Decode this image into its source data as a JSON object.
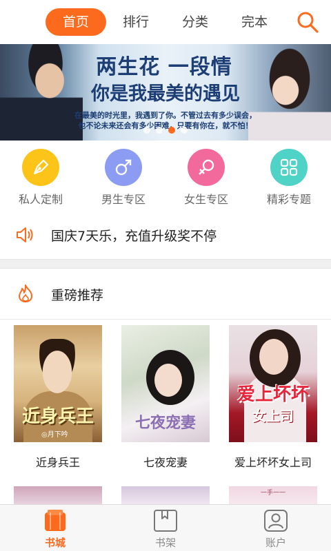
{
  "topnav": {
    "tabs": [
      {
        "label": "首页",
        "active": true
      },
      {
        "label": "排行",
        "active": false
      },
      {
        "label": "分类",
        "active": false
      },
      {
        "label": "完本",
        "active": false
      }
    ],
    "search_icon": "search-icon",
    "accent_color": "#fb6a1d"
  },
  "banner": {
    "title_line1": "两生花 一段情",
    "title_line2": "你是我最美的遇见",
    "subtitle_line1": "在最美的时光里，我遇到了你。不管过去有多少误会，",
    "subtitle_line2": "也不论未来还会有多少困难，只要有你在，就不怕！",
    "dots_count": 4,
    "active_dot_index": 2
  },
  "categories": [
    {
      "label": "私人定制",
      "icon": "pen-nib-icon",
      "color": "#fcc419"
    },
    {
      "label": "男生专区",
      "icon": "male-symbol-icon",
      "color": "#8b9cf2"
    },
    {
      "label": "女生专区",
      "icon": "female-symbol-icon",
      "color": "#f26a9b"
    },
    {
      "label": "精彩专题",
      "icon": "grid-icon",
      "color": "#4fd3c7"
    }
  ],
  "notice": {
    "icon": "speaker-icon",
    "text": "国庆7天乐，充值升级奖不停"
  },
  "section": {
    "icon": "fire-icon",
    "title": "重磅推荐"
  },
  "books": [
    {
      "title": "近身兵王",
      "cover_title": "近身兵王",
      "cover_author": "◎月下吟"
    },
    {
      "title": "七夜宠妻",
      "cover_title": "七夜宠妻"
    },
    {
      "title": "爱上坏坏女上司",
      "cover_title": "爱上坏坏",
      "cover_title2": "女上司"
    }
  ],
  "peek_row": {
    "third_text": "一手一一"
  },
  "bottombar": {
    "items": [
      {
        "label": "书城",
        "icon": "bookstore-icon",
        "active": true
      },
      {
        "label": "书架",
        "icon": "bookshelf-icon",
        "active": false
      },
      {
        "label": "账户",
        "icon": "account-icon",
        "active": false
      }
    ]
  }
}
